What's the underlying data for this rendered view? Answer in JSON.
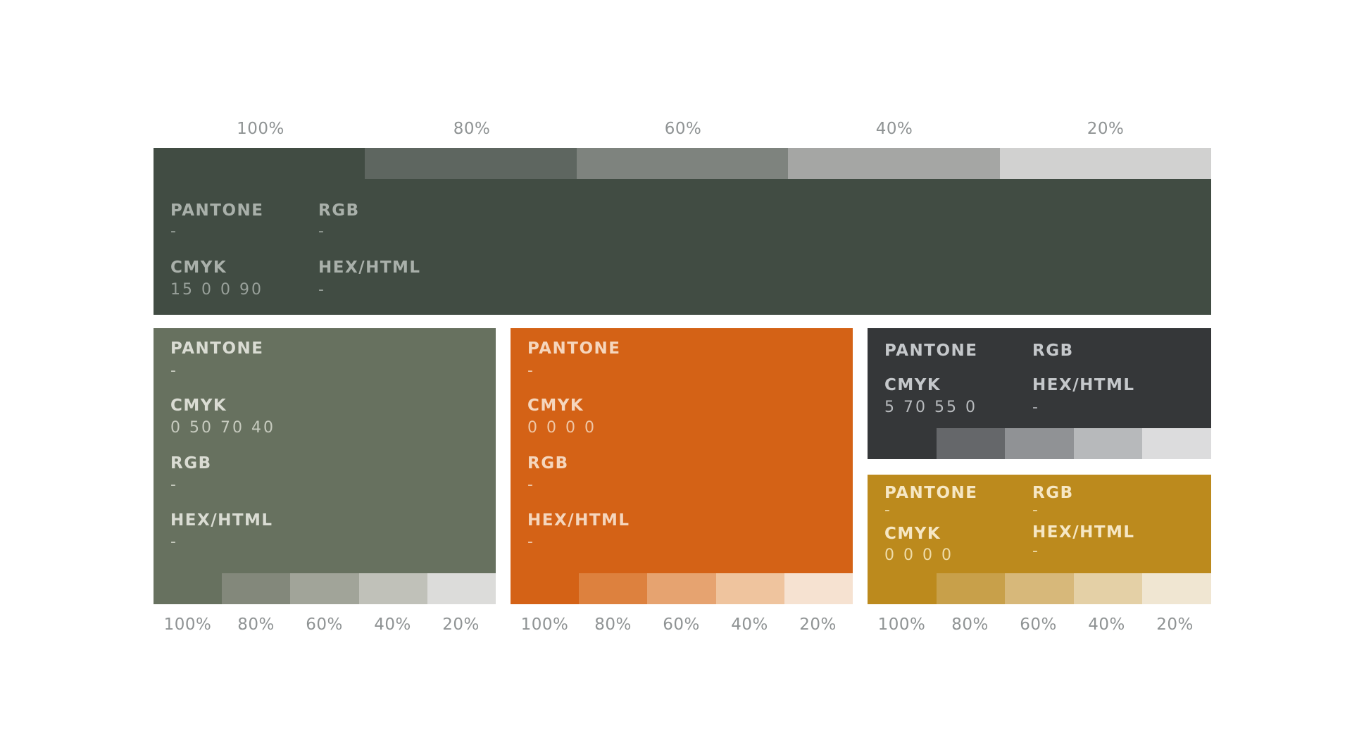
{
  "top_percent_labels": [
    "100%",
    "80%",
    "60%",
    "40%",
    "20%"
  ],
  "bottom_percent_labels": [
    "100%",
    "80%",
    "60%",
    "40%",
    "20%"
  ],
  "field_labels": {
    "pantone": "PANTONE",
    "rgb": "RGB",
    "cmyk": "CMYK",
    "hex": "HEX/HTML"
  },
  "swatches": {
    "primary_dark_green": {
      "color": "#414c43",
      "text_color": "#a9b0aa",
      "value_color": "#98a09a",
      "pantone": "-",
      "rgb": "-",
      "cmyk": "15 0 0 90",
      "hex": "-",
      "tints": [
        "#414c43",
        "#5e6660",
        "#7e837e",
        "#a5a6a4",
        "#d1d1d0"
      ]
    },
    "sage_green": {
      "color": "#67715f",
      "text_color": "#dadcd3",
      "value_color": "#c6cabe",
      "pantone": "-",
      "cmyk": "0 50 70 40",
      "rgb": "-",
      "hex": "-",
      "tints": [
        "#67715f",
        "#83887b",
        "#a1a499",
        "#c0c1b9",
        "#dcdcda"
      ]
    },
    "orange": {
      "color": "#d46216",
      "text_color": "#f5d6bd",
      "value_color": "#efc6a5",
      "pantone": "-",
      "cmyk": "0 0 0 0",
      "rgb": "-",
      "hex": "-",
      "tints": [
        "#d46216",
        "#dd813e",
        "#e6a370",
        "#efc49e",
        "#f6e2d1"
      ]
    },
    "charcoal": {
      "color": "#353739",
      "text_color": "#c5c8cb",
      "value_color": "#b8bbbe",
      "pantone": "",
      "rgb": "",
      "cmyk": "5 70 55 0",
      "hex": "-",
      "tints": [
        "#353739",
        "#65676a",
        "#909295",
        "#b7b9bb",
        "#dcdcdd"
      ]
    },
    "mustard": {
      "color": "#bc8a1d",
      "text_color": "#f6e7c4",
      "value_color": "#efdca9",
      "pantone": "-",
      "rgb": "-",
      "cmyk": "0 0 0 0",
      "hex": "-",
      "tints": [
        "#bc8a1d",
        "#c8a04a",
        "#d7b87a",
        "#e4d0a6",
        "#f0e6d2"
      ]
    }
  }
}
